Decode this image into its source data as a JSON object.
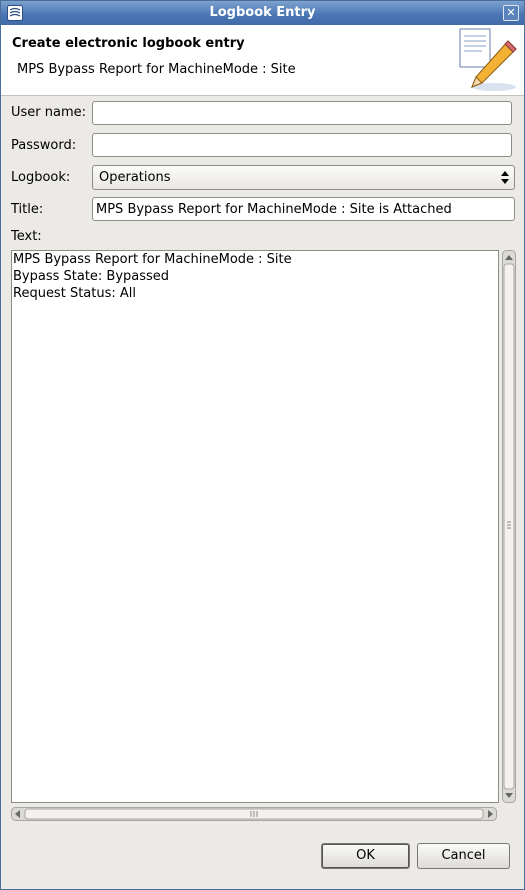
{
  "window": {
    "title": "Logbook Entry",
    "app_icon": "app-icon",
    "close_icon": "close-icon"
  },
  "header": {
    "heading": "Create electronic logbook entry",
    "subheading": "MPS Bypass Report for MachineMode : Site",
    "icon": "notepad-pencil-icon"
  },
  "form": {
    "username_label": "User name:",
    "username_value": "",
    "password_label": "Password:",
    "password_value": "",
    "logbook_label": "Logbook:",
    "logbook_value": "Operations",
    "title_label": "Title:",
    "title_value": "MPS Bypass Report for MachineMode : Site is Attached",
    "text_label": "Text:",
    "text_lines": [
      "MPS Bypass Report for MachineMode : Site",
      "Bypass State: Bypassed",
      "Request Status: All"
    ]
  },
  "buttons": {
    "ok": "OK",
    "cancel": "Cancel"
  },
  "colors": {
    "titlebar": "#4b78b4",
    "background": "#eceae6",
    "field_border": "#8e8c86"
  }
}
